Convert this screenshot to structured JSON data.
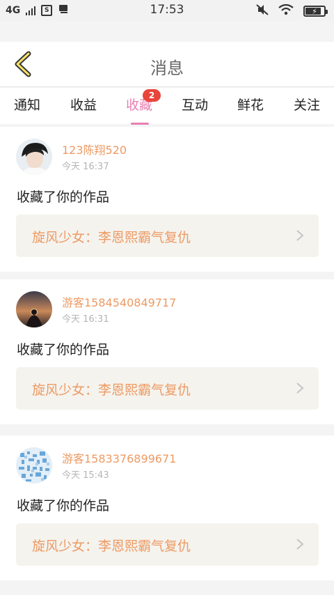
{
  "status_bar": {
    "network": "4G",
    "time": "17:53",
    "icons": [
      "signal-icon",
      "screenshot-icon",
      "notification-icon",
      "mute-icon",
      "wifi-icon",
      "battery-icon"
    ]
  },
  "header": {
    "title": "消息",
    "back_icon": "chevron-left-icon"
  },
  "tabs": [
    {
      "label": "通知"
    },
    {
      "label": "收益"
    },
    {
      "label": "收藏",
      "badge": "2",
      "active": true
    },
    {
      "label": "互动"
    },
    {
      "label": "鲜花"
    },
    {
      "label": "关注"
    }
  ],
  "colors": {
    "accent_pink": "#e97fb2",
    "accent_orange": "#ed9a63",
    "badge_red": "#e8453c"
  },
  "messages": [
    {
      "username": "123陈翔520",
      "time": "今天 16:37",
      "action": "收藏了你的作品",
      "work_title": "旋风少女：李恩熙霸气复仇"
    },
    {
      "username": "游客1584540849717",
      "time": "今天 16:31",
      "action": "收藏了你的作品",
      "work_title": "旋风少女：李恩熙霸气复仇"
    },
    {
      "username": "游客1583376899671",
      "time": "今天 15:43",
      "action": "收藏了你的作品",
      "work_title": "旋风少女：李恩熙霸气复仇"
    }
  ]
}
